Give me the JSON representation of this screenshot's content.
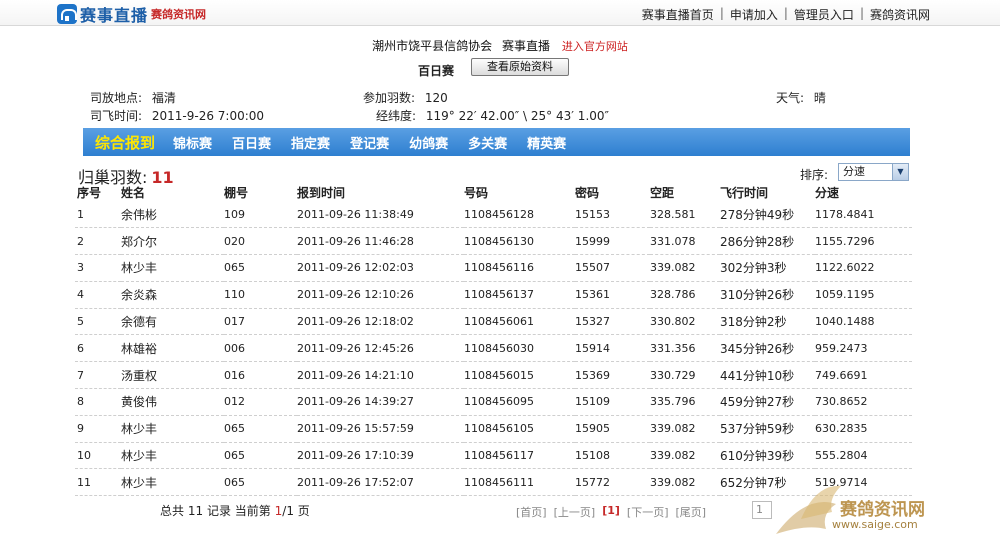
{
  "header": {
    "logo_title": "赛事直播",
    "logo_sub": "赛鸽资讯网",
    "nav": [
      {
        "label": "赛事直播首页"
      },
      {
        "label": "申请加入"
      },
      {
        "label": "管理员入口"
      },
      {
        "label": "赛鸽资讯网"
      }
    ]
  },
  "race": {
    "association": "潮州市饶平县信鸽协会",
    "live_label": "赛事直播",
    "official_link": "进入官方网站",
    "name": "百日赛",
    "original_button": "查看原始资料",
    "release_place_label": "司放地点:",
    "release_place": "福清",
    "release_time_label": "司飞时间:",
    "release_time": "2011-9-26 7:00:00",
    "entries_label": "参加羽数:",
    "entries": "120",
    "coords_label": "经纬度:",
    "coords": "119° 22′ 42.00″ \\ 25° 43′ 1.00″",
    "weather_label": "天气:",
    "weather": "晴"
  },
  "tabs": [
    {
      "label": "综合报到",
      "active": true
    },
    {
      "label": "锦标赛"
    },
    {
      "label": "百日赛"
    },
    {
      "label": "指定赛"
    },
    {
      "label": "登记赛"
    },
    {
      "label": "幼鸽赛"
    },
    {
      "label": "多关赛"
    },
    {
      "label": "精英赛"
    }
  ],
  "summary": {
    "returned_label": "归巢羽数:",
    "returned_count": "11",
    "sort_label": "排序:",
    "sort_value": "分速"
  },
  "table": {
    "columns": [
      "序号",
      "姓名",
      "棚号",
      "报到时间",
      "号码",
      "密码",
      "空距",
      "飞行时间",
      "分速"
    ],
    "rows": [
      [
        "1",
        "余伟彬",
        "109",
        "2011-09-26 11:38:49",
        "1108456128",
        "15153",
        "328.581",
        "278分钟49秒",
        "1178.4841"
      ],
      [
        "2",
        "郑介尔",
        "020",
        "2011-09-26 11:46:28",
        "1108456130",
        "15999",
        "331.078",
        "286分钟28秒",
        "1155.7296"
      ],
      [
        "3",
        "林少丰",
        "065",
        "2011-09-26 12:02:03",
        "1108456116",
        "15507",
        "339.082",
        "302分钟3秒",
        "1122.6022"
      ],
      [
        "4",
        "余炎森",
        "110",
        "2011-09-26 12:10:26",
        "1108456137",
        "15361",
        "328.786",
        "310分钟26秒",
        "1059.1195"
      ],
      [
        "5",
        "余德有",
        "017",
        "2011-09-26 12:18:02",
        "1108456061",
        "15327",
        "330.802",
        "318分钟2秒",
        "1040.1488"
      ],
      [
        "6",
        "林雄裕",
        "006",
        "2011-09-26 12:45:26",
        "1108456030",
        "15914",
        "331.356",
        "345分钟26秒",
        "959.2473"
      ],
      [
        "7",
        "汤重权",
        "016",
        "2011-09-26 14:21:10",
        "1108456015",
        "15369",
        "330.729",
        "441分钟10秒",
        "749.6691"
      ],
      [
        "8",
        "黄俊伟",
        "012",
        "2011-09-26 14:39:27",
        "1108456095",
        "15109",
        "335.796",
        "459分钟27秒",
        "730.8652"
      ],
      [
        "9",
        "林少丰",
        "065",
        "2011-09-26 15:57:59",
        "1108456105",
        "15905",
        "339.082",
        "537分钟59秒",
        "630.2835"
      ],
      [
        "10",
        "林少丰",
        "065",
        "2011-09-26 17:10:39",
        "1108456117",
        "15108",
        "339.082",
        "610分钟39秒",
        "555.2804"
      ],
      [
        "11",
        "林少丰",
        "065",
        "2011-09-26 17:52:07",
        "1108456111",
        "15772",
        "339.082",
        "652分钟7秒",
        "519.9714"
      ]
    ]
  },
  "footer": {
    "total_prefix": "总共",
    "total_count": "11",
    "total_unit": "记录",
    "current_label": "当前第",
    "current_page": "1",
    "page_total": "/1",
    "page_unit": "页",
    "pager": [
      "[首页]",
      "[上一页]",
      "[1]",
      "[下一页]",
      "[尾页]"
    ],
    "page_box": "1"
  },
  "watermark": {
    "text": "赛鸽资讯网",
    "url": "www.saige.com"
  },
  "colors": {
    "nav_blue": "#2e7fd0",
    "active_tab": "#ffe600",
    "accent_red": "#c62828"
  }
}
